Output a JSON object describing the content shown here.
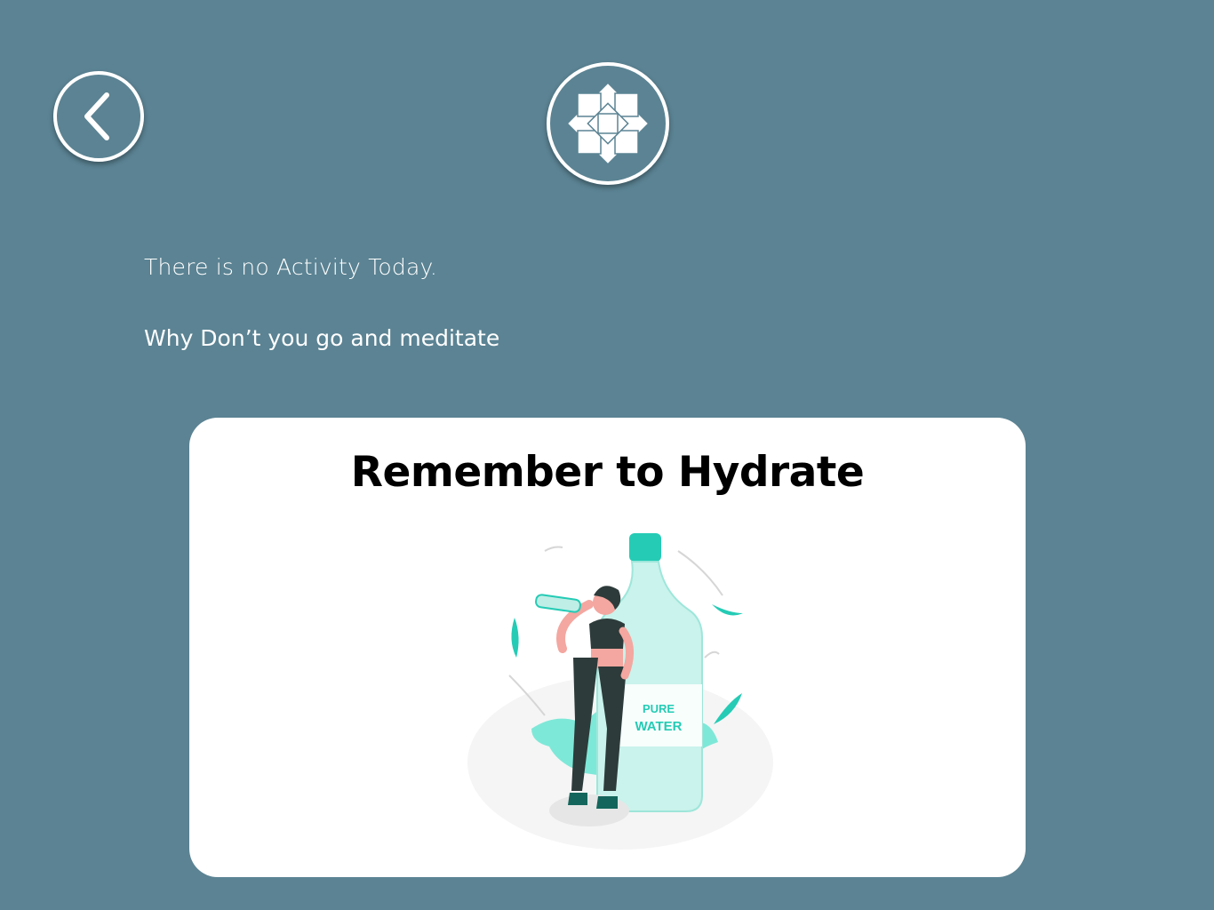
{
  "header": {
    "back_icon": "chevron-left-icon",
    "logo_icon": "lotus-flower-icon"
  },
  "main": {
    "status_text": "There is no Activity Today.",
    "prompt_text": "Why Don’t you go and meditate"
  },
  "card": {
    "title": "Remember to Hydrate",
    "bottle_label_line1": "PURE",
    "bottle_label_line2": "WATER"
  },
  "colors": {
    "background": "#5b8393",
    "accent": "#25cbb5",
    "card": "#ffffff"
  }
}
